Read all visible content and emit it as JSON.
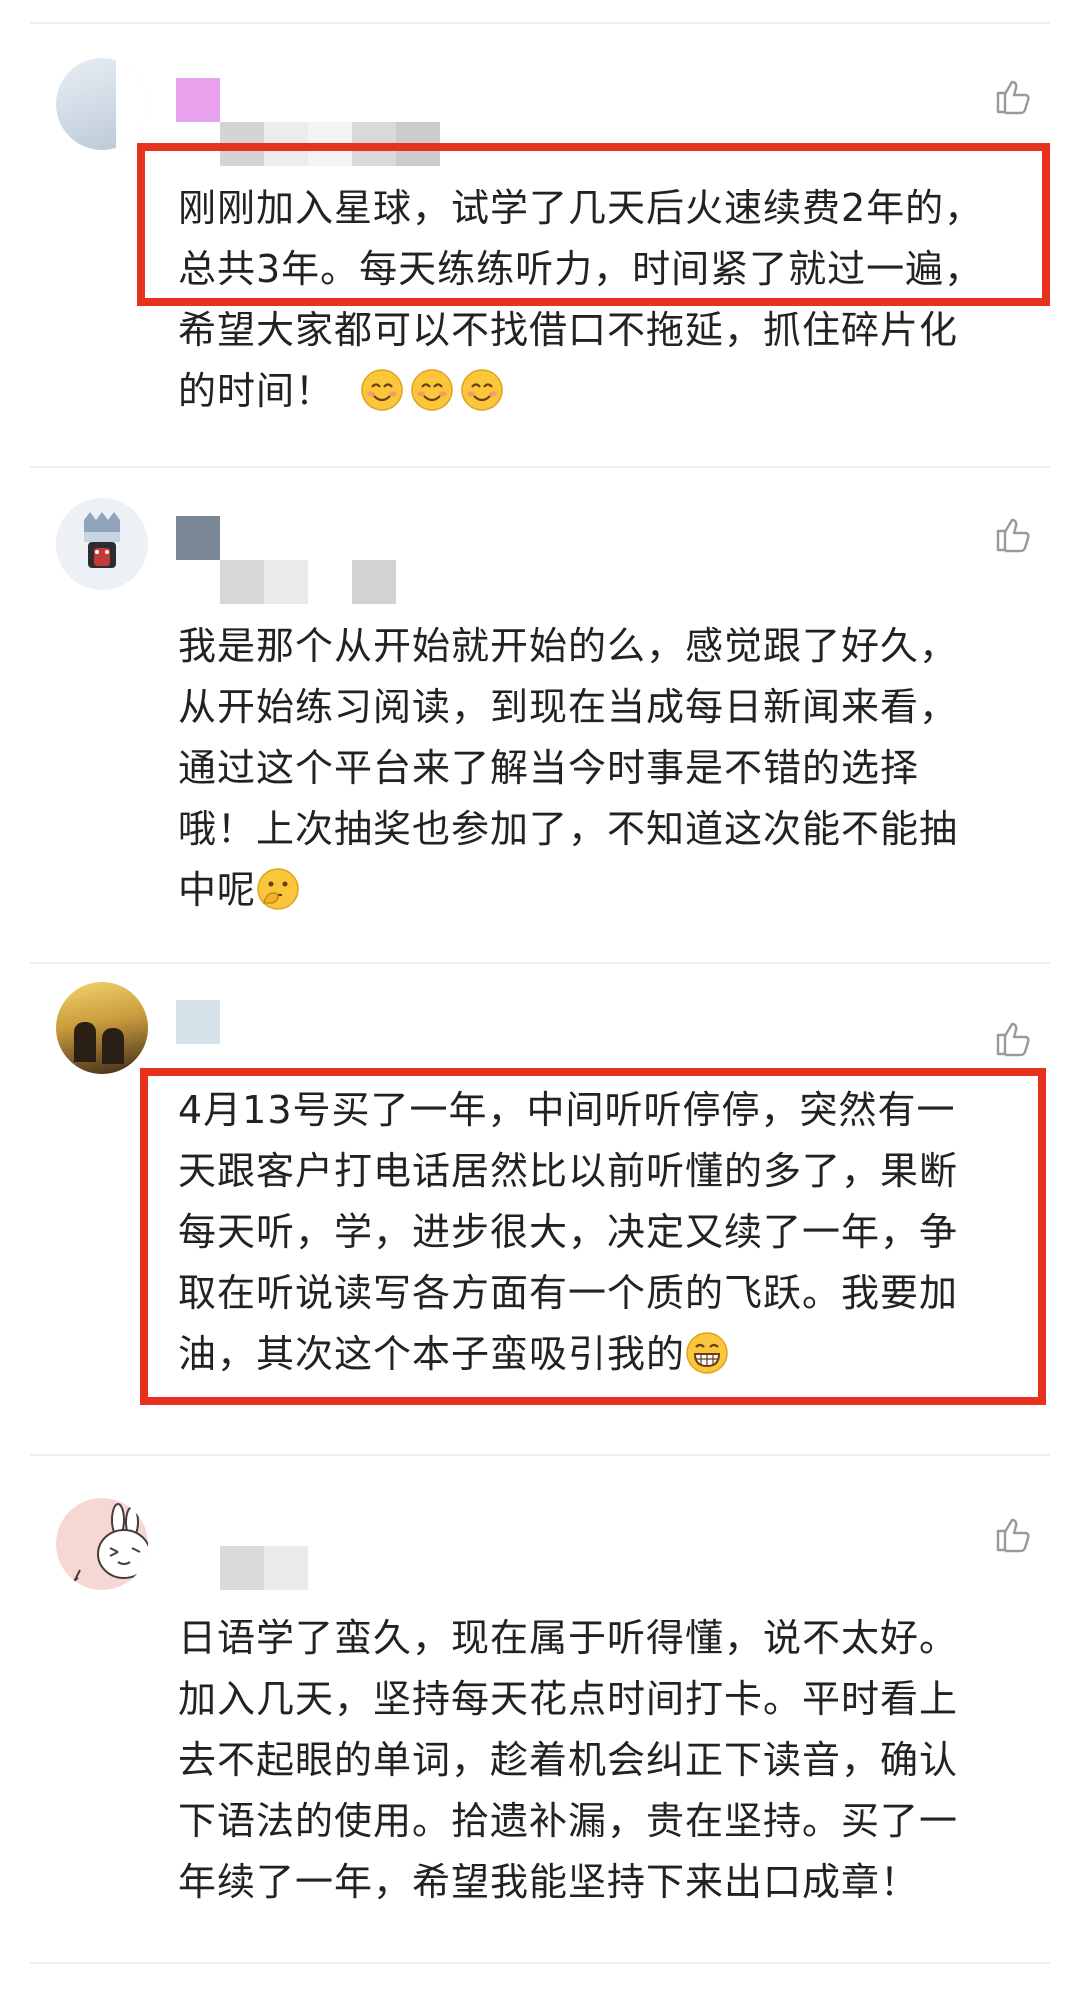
{
  "comments": [
    {
      "id": 1,
      "text_lines": [
        "刚刚加入星球，试学了几天后火速续费2年的，",
        "总共3年。每天练练听力，时间紧了就过一遍，",
        "希望大家都可以不找借口不拖延，抓住碎片化",
        "的时间！"
      ],
      "emojis": [
        "smiling-face-icon",
        "smiling-face-icon",
        "smiling-face-icon"
      ],
      "highlighted": true
    },
    {
      "id": 2,
      "text_lines": [
        "我是那个从开始就开始的么，感觉跟了好久，",
        "从开始练习阅读，到现在当成每日新闻来看，",
        "通过这个平台来了解当今时事是不错的选择",
        "哦！上次抽奖也参加了，不知道这次能不能抽",
        "中呢"
      ],
      "emojis": [
        "thinking-face-icon"
      ],
      "highlighted": false
    },
    {
      "id": 3,
      "text_lines": [
        "4月13号买了一年，中间听听停停，突然有一",
        "天跟客户打电话居然比以前听懂的多了，果断",
        "每天听，学，进步很大，决定又续了一年，争",
        "取在听说读写各方面有一个质的飞跃。我要加",
        "油，其次这个本子蛮吸引我的"
      ],
      "emojis": [
        "grinning-face-icon"
      ],
      "highlighted": true
    },
    {
      "id": 4,
      "text_lines": [
        "日语学了蛮久，现在属于听得懂，说不太好。",
        "加入几天，坚持每天花点时间打卡。平时看上",
        "去不起眼的单词，趁着机会纠正下读音，确认",
        "下语法的使用。拾遗补漏，贵在坚持。买了一",
        "年续了一年，希望我能坚持下来出口成章！"
      ],
      "emojis": [],
      "highlighted": false
    }
  ],
  "colors": {
    "highlight_border": "#e8311f",
    "text": "#222222",
    "divider": "#f0f0f0",
    "like_icon": "#9a9a9a"
  }
}
